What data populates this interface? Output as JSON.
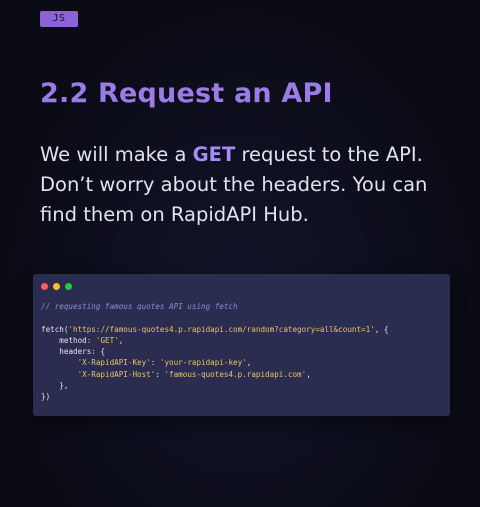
{
  "badge": {
    "label": "JS"
  },
  "heading": {
    "title": "2.2 Request an API"
  },
  "intro": {
    "before": "We will make a ",
    "keyword": "GET",
    "after": " request to the API. Don’t worry about the headers. You can find them on RapidAPI Hub."
  },
  "code": {
    "comment": "// requesting famous quotes API using fetch",
    "fetch_open": "fetch(",
    "url": "'https://famous-quotes4.p.rapidapi.com/random?category=all&count=1'",
    "fetch_open_tail": ", {",
    "method_key": "method: ",
    "method_value": "'GET'",
    "method_tail": ",",
    "headers_key": "headers: {",
    "key_header_name": "'X-RapidAPI-Key'",
    "key_header_sep": ": ",
    "key_header_value": "'your-rapidapi-key'",
    "key_header_tail": ",",
    "host_header_name": "'X-RapidAPI-Host'",
    "host_header_sep": ": ",
    "host_header_value": "'famous-quotes4.p.rapidapi.com'",
    "host_header_tail": ",",
    "headers_close": "},",
    "fetch_close": "})"
  },
  "window_controls": [
    "close-dot",
    "minimize-dot",
    "maximize-dot"
  ],
  "colors": {
    "background": "#0b0b16",
    "accent": "#9b7be6",
    "code_bg": "#2a2c50",
    "string": "#e9c46a"
  }
}
